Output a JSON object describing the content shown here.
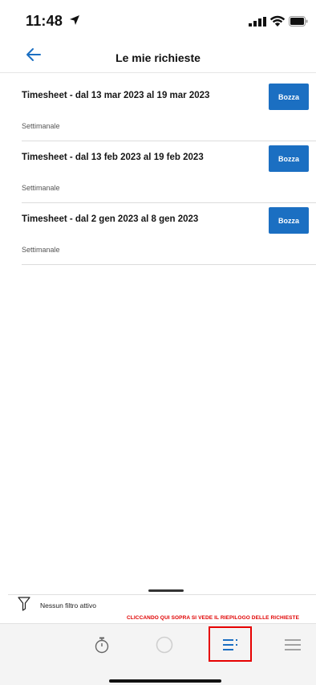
{
  "status": {
    "time": "11:48"
  },
  "header": {
    "title": "Le mie richieste"
  },
  "requests": [
    {
      "title": "Timesheet - dal 13 mar 2023 al 19 mar 2023",
      "subtitle": "Settimanale",
      "status": "Bozza"
    },
    {
      "title": "Timesheet - dal 13 feb 2023 al 19 feb 2023",
      "subtitle": "Settimanale",
      "status": "Bozza"
    },
    {
      "title": "Timesheet - dal 2 gen 2023 al 8 gen 2023",
      "subtitle": "Settimanale",
      "status": "Bozza"
    }
  ],
  "filter": {
    "label": "Nessun filtro attivo"
  },
  "annotation": {
    "text": "CLICCANDO QUI SOPRA SI VEDE IL RIEPILOGO DELLE RICHIESTE"
  },
  "tabbar": {
    "items": [
      {
        "icon": "stopwatch-icon",
        "active": false
      },
      {
        "icon": "circle-icon",
        "active": false
      },
      {
        "icon": "list-icon",
        "active": true
      },
      {
        "icon": "menu-icon",
        "active": false
      }
    ]
  },
  "colors": {
    "accent": "#1b6fc2",
    "annotation": "#e00000"
  }
}
